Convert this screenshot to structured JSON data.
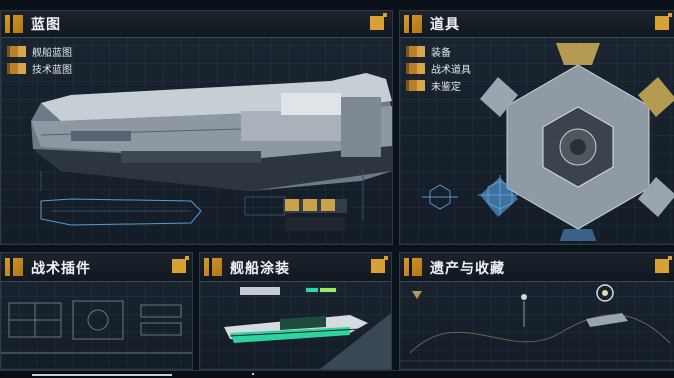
{
  "panels": {
    "blueprint": {
      "title": "蓝图",
      "items": [
        {
          "label": "舰船蓝图"
        },
        {
          "label": "技术蓝图"
        }
      ]
    },
    "items": {
      "title": "道具",
      "items": [
        {
          "label": "装备"
        },
        {
          "label": "战术道具"
        },
        {
          "label": "未鉴定"
        }
      ]
    },
    "tactical_plugins": {
      "title": "战术插件"
    },
    "ship_paint": {
      "title": "舰船涂装"
    },
    "relics": {
      "title": "遗产与收藏"
    }
  },
  "colors": {
    "accent_gold": "#d9a133",
    "panel_bg": "#18222d",
    "header_bg": "#141b23",
    "text": "#eef2f5",
    "blueprint_blue": "#5fa8e8",
    "paint_green": "#2fd3a0"
  },
  "icons": {
    "header_mark": "striped-square-icon",
    "corner_mark": "gold-square-icon",
    "nav_bullet": "gold-bar-icon"
  }
}
